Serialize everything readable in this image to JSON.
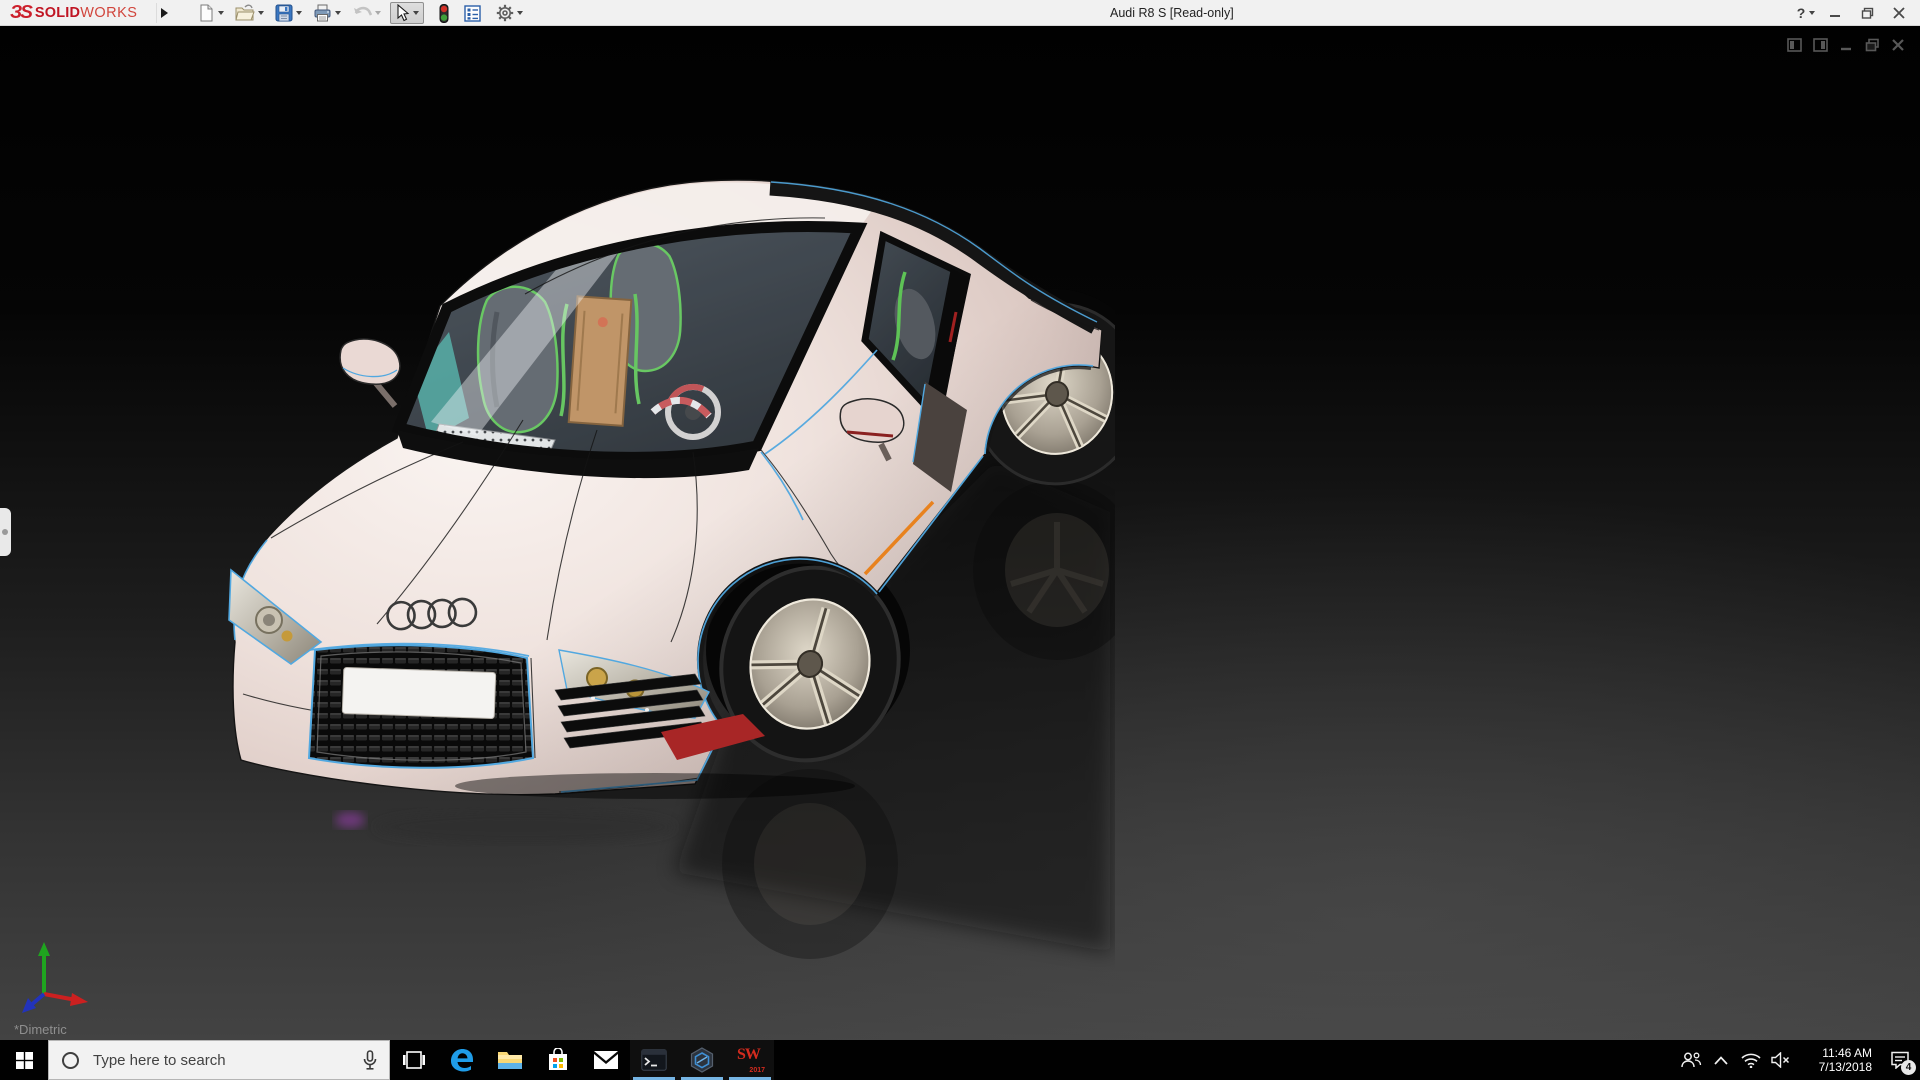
{
  "window": {
    "title": "Audi R8 S [Read-only]",
    "help_label": "?"
  },
  "brand": {
    "glyph": "ЗS",
    "solid": "SOLID",
    "works": "WORKS"
  },
  "toolbar": {
    "items": [
      {
        "name": "new-document",
        "dropdown": true,
        "state": "enabled"
      },
      {
        "name": "open",
        "dropdown": true,
        "state": "enabled"
      },
      {
        "name": "save",
        "dropdown": true,
        "state": "enabled"
      },
      {
        "name": "print",
        "dropdown": true,
        "state": "enabled"
      },
      {
        "name": "undo",
        "dropdown": true,
        "state": "disabled"
      },
      {
        "name": "select",
        "dropdown": true,
        "state": "selected"
      },
      {
        "name": "rebuild-traffic-light",
        "dropdown": false,
        "state": "enabled"
      },
      {
        "name": "options-list",
        "dropdown": false,
        "state": "enabled"
      },
      {
        "name": "settings-gear",
        "dropdown": true,
        "state": "enabled"
      }
    ]
  },
  "viewport": {
    "orientation_label": "*Dimetric",
    "document_controls": [
      "pane-left",
      "pane-right",
      "minimize",
      "restore",
      "close"
    ]
  },
  "taskbar": {
    "search_placeholder": "Type here to search",
    "apps": [
      {
        "name": "task-view",
        "open": false
      },
      {
        "name": "microsoft-edge",
        "open": false
      },
      {
        "name": "file-explorer",
        "open": false
      },
      {
        "name": "microsoft-store",
        "open": false
      },
      {
        "name": "mail",
        "open": false
      },
      {
        "name": "command-prompt",
        "open": true
      },
      {
        "name": "hexagon-app",
        "open": true
      },
      {
        "name": "solidworks-2017",
        "open": true
      }
    ],
    "sw_logo": {
      "top": "SW",
      "year": "2017"
    },
    "tray": {
      "time": "11:46 AM",
      "date": "7/13/2018",
      "notification_count": "4"
    }
  },
  "colors": {
    "accent_edge_blue": "#51a8e0",
    "solidworks_red": "#cc1f2b",
    "taskbar_underline": "#76b5e4",
    "car_body": "#e9dcd7",
    "door_accent_orange": "#e8821e"
  }
}
